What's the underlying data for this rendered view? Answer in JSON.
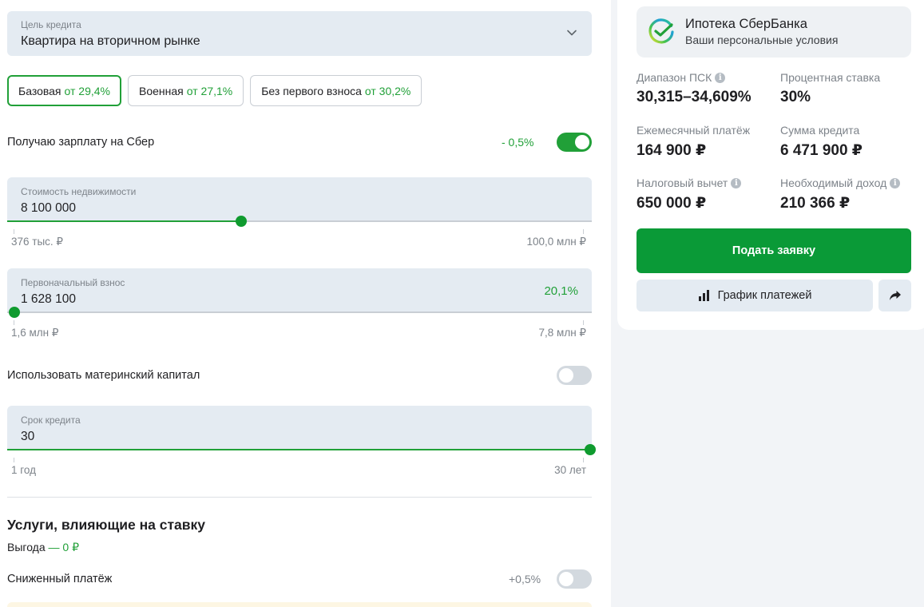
{
  "purpose": {
    "label": "Цель кредита",
    "value": "Квартира на вторичном рынке"
  },
  "programs": [
    {
      "name": "Базовая",
      "rate": "от 29,4%",
      "active": true
    },
    {
      "name": "Военная",
      "rate": "от 27,1%",
      "active": false
    },
    {
      "name": "Без первого взноса",
      "rate": "от 30,2%",
      "active": false
    }
  ],
  "salary": {
    "label": "Получаю зарплату на Сбер",
    "discount": "- 0,5%",
    "on": true
  },
  "property_cost": {
    "label": "Стоимость недвижимости",
    "value": "8 100 000",
    "min": "376 тыс. ₽",
    "max": "100,0 млн ₽",
    "fraction": 0.4
  },
  "down_payment": {
    "label": "Первоначальный взнос",
    "value": "1 628 100",
    "percent": "20,1%",
    "min": "1,6 млн ₽",
    "max": "7,8 млн ₽",
    "fraction": 0.0
  },
  "maternity": {
    "label": "Использовать материнский капитал",
    "on": false
  },
  "term": {
    "label": "Срок кредита",
    "value": "30",
    "min": "1 год",
    "max": "30 лет",
    "fraction": 1.0
  },
  "services": {
    "title": "Услуги, влияющие на ставку",
    "benefit_label": "Выгода",
    "benefit_value": "— 0 ₽",
    "reduced_payment": {
      "label": "Сниженный платёж",
      "delta": "+0,5%",
      "on": false
    }
  },
  "brand": {
    "title": "Ипотека СберБанка",
    "subtitle": "Ваши персональные условия"
  },
  "metrics": {
    "psk": {
      "label": "Диапазон ПСК",
      "value": "30,315–34,609%"
    },
    "rate": {
      "label": "Процентная ставка",
      "value": "30%"
    },
    "monthly": {
      "label": "Ежемесячный платёж",
      "value": "164 900 ₽"
    },
    "loan": {
      "label": "Сумма кредита",
      "value": "6 471 900 ₽"
    },
    "tax": {
      "label": "Налоговый вычет",
      "value": "650 000 ₽"
    },
    "income": {
      "label": "Необходимый доход",
      "value": "210 366 ₽"
    }
  },
  "actions": {
    "apply": "Подать заявку",
    "schedule": "График платежей"
  },
  "colors": {
    "accent": "#21a038",
    "button": "#0a9a37",
    "field_bg": "#e4ebf2"
  }
}
